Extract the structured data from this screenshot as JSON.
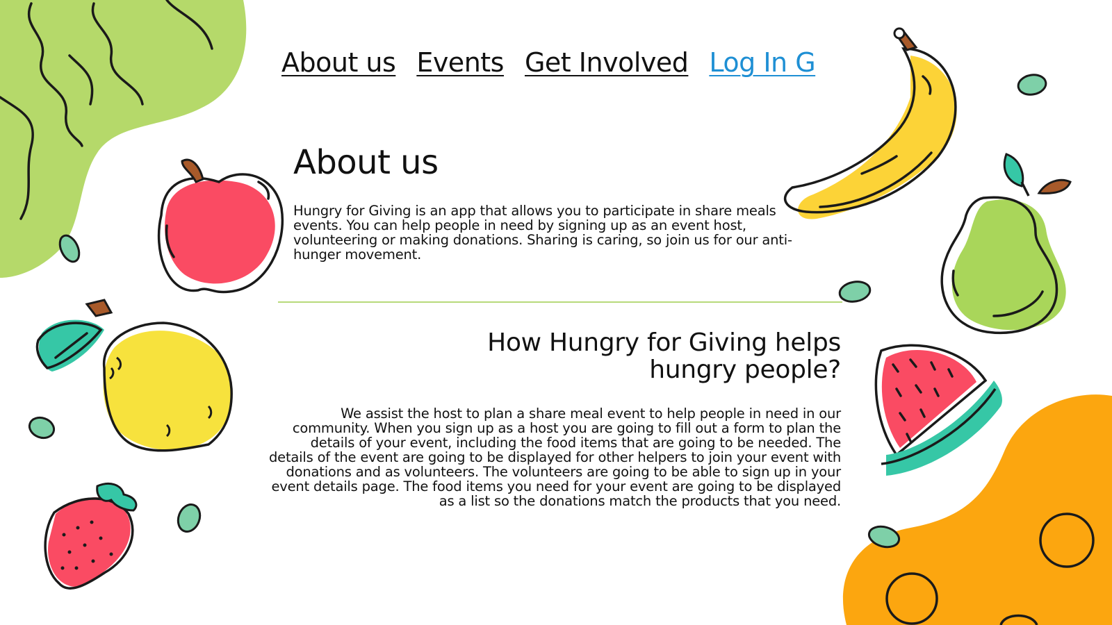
{
  "nav": {
    "about": "About us",
    "events": "Events",
    "get_involved": "Get Involved",
    "login": "Log In G"
  },
  "about": {
    "title": "About us",
    "body": "Hungry for Giving is an app that allows you to participate in share meals events. You can help people in need by signing up as an event host, volunteering or making donations. Sharing is caring, so join us for our anti-hunger movement."
  },
  "how": {
    "title": "How Hungry for Giving helps hungry people?",
    "body": "We assist the host to plan a share meal event to help people in need in our community. When you sign up as a host you are going to fill out a form to plan the details of your event, including the food items that are going to be needed.  The details of the event are going to be displayed for other helpers to join your event with donations and as volunteers. The volunteers are going to be able to sign up in your event details page. The food items you need for your event are going to be displayed as a list so the donations match the products that you need."
  },
  "colors": {
    "link": "#1e8fd4",
    "divider": "#b7d97a",
    "lime_blob": "#b5d96a",
    "orange_blob": "#fca60f",
    "apple": "#fa4b63",
    "banana": "#fcd337",
    "pear": "#a9d65a",
    "lemon": "#f7e23d",
    "leaf": "#36c7a6"
  },
  "decorations": [
    "green-blob",
    "orange-blob",
    "apple-icon",
    "banana-icon",
    "pear-icon",
    "lemon-icon",
    "strawberry-icon",
    "watermelon-icon",
    "seed-icon"
  ]
}
